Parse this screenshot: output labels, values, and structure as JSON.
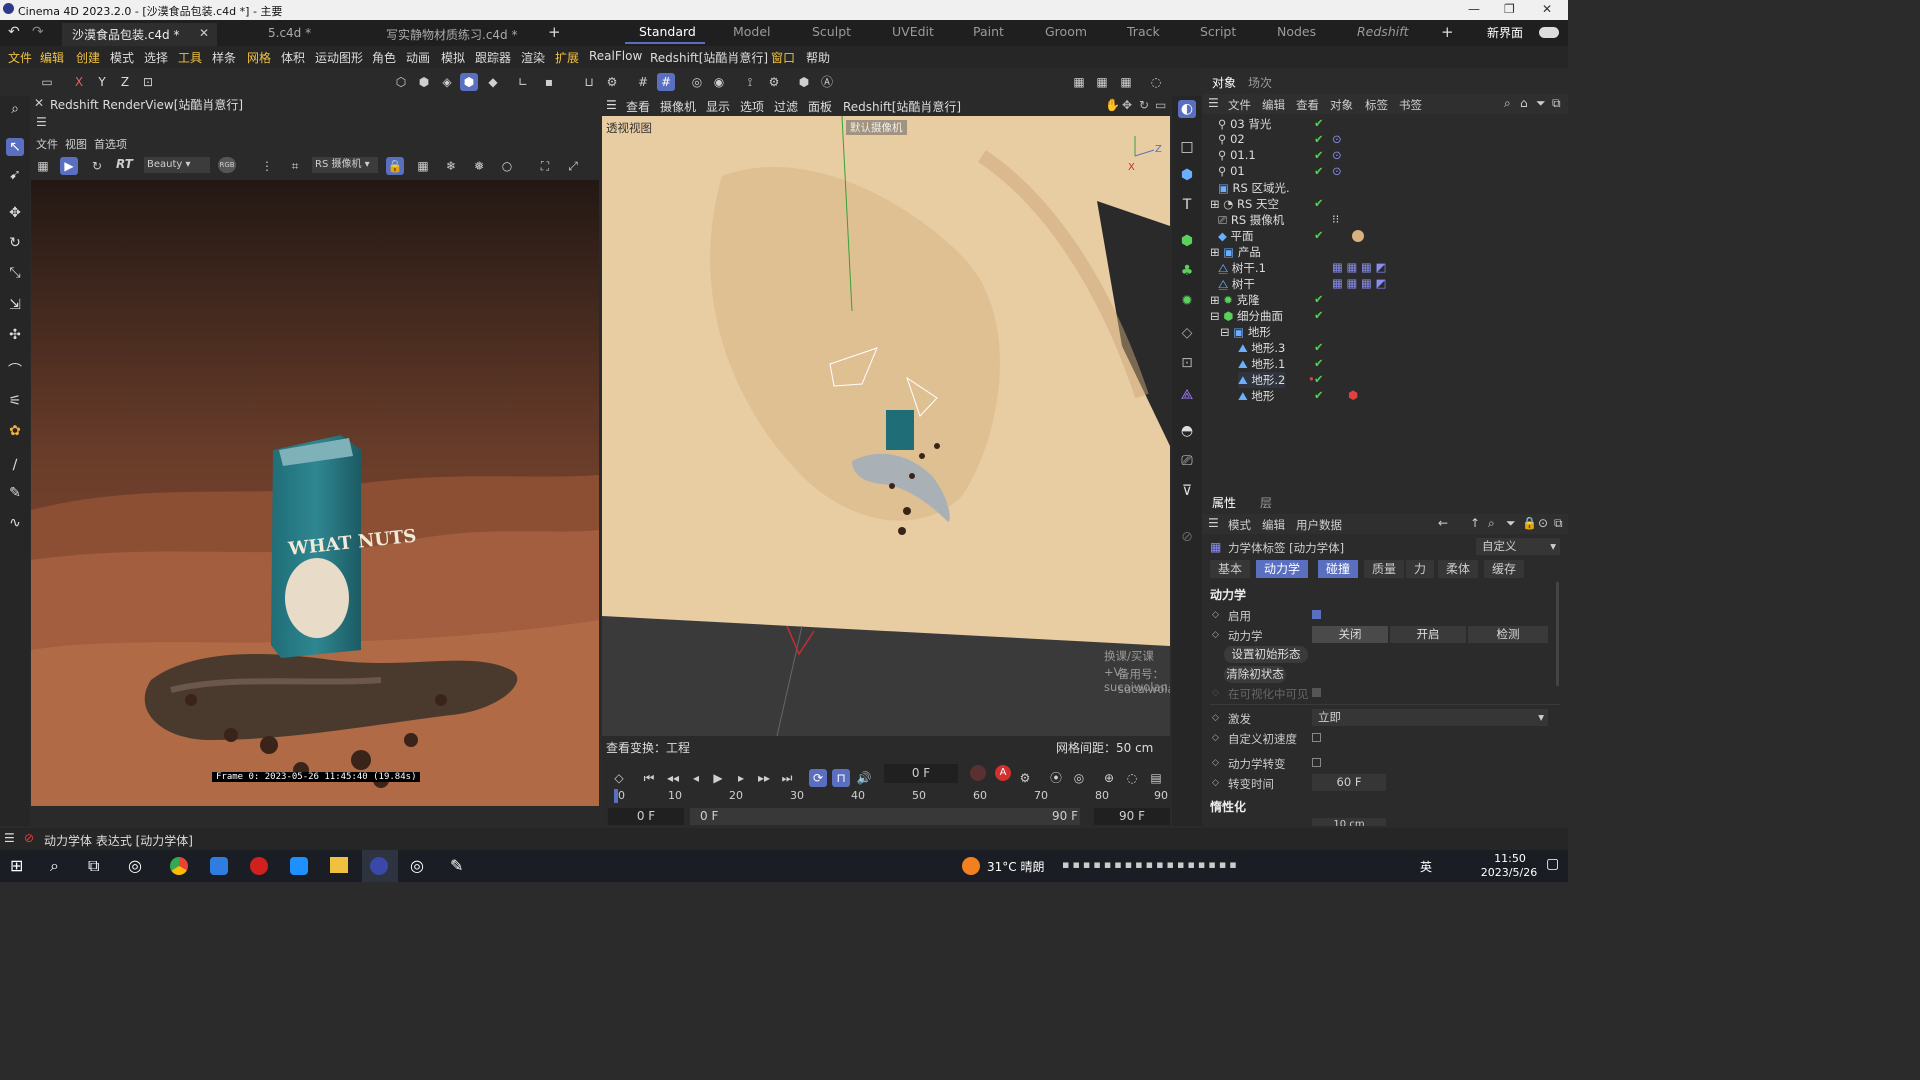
{
  "window": {
    "title": "Cinema 4D 2023.2.0 - [沙漠食品包装.c4d *] - 主要"
  },
  "doc_tabs": [
    {
      "label": "沙漠食品包装.c4d *",
      "active": true
    },
    {
      "label": "5.c4d *",
      "active": false
    },
    {
      "label": "写实静物材质练习.c4d *",
      "active": false
    }
  ],
  "layout_tabs": [
    "Standard",
    "Model",
    "Sculpt",
    "UVEdit",
    "Paint",
    "Groom",
    "Track",
    "Script",
    "Nodes",
    "Redshift"
  ],
  "new_interface": "新界面",
  "menu": [
    "文件",
    "编辑",
    "创建",
    "模式",
    "选择",
    "工具",
    "样条",
    "网格",
    "体积",
    "运动图形",
    "角色",
    "动画",
    "模拟",
    "跟踪器",
    "渲染",
    "扩展",
    "RealFlow",
    "Redshift[站酷肖意行]",
    "窗口",
    "帮助"
  ],
  "axes": {
    "x": "X",
    "y": "Y",
    "z": "Z"
  },
  "renderview": {
    "title": "Redshift RenderView[站酷肖意行]",
    "menu": [
      "文件",
      "视图",
      "首选项"
    ],
    "aov": "Beauty",
    "rgb": "RGB",
    "camera": "RS 摄像机",
    "rt": "RT",
    "frame_info": "Frame  0:  2023-05-26  11:45:40  (19.84s)",
    "package_text": "WHAT NUTS"
  },
  "viewport": {
    "menu": [
      "查看",
      "摄像机",
      "显示",
      "选项",
      "过滤",
      "面板",
      "Redshift[站酷肖意行]"
    ],
    "label": "透视视图",
    "camera_label": "默认摄像机",
    "watermark1": "换课/买课+V：sucaiwolan",
    "watermark2": "备用号：sucaiwolan",
    "footer_left": "查看变换：工程",
    "footer_right": "网格间距：50 cm"
  },
  "timeline": {
    "current_frame": "0 F",
    "ticks": [
      "0",
      "10",
      "20",
      "30",
      "40",
      "50",
      "60",
      "70",
      "80",
      "90"
    ],
    "start": "0 F",
    "range_start": "0 F",
    "range_end": "90 F",
    "end": "90 F"
  },
  "objects_panel": {
    "tabs": [
      "对象",
      "场次"
    ],
    "menu": [
      "文件",
      "编辑",
      "查看",
      "对象",
      "标签",
      "书签"
    ],
    "items": [
      "03 背光",
      "02",
      "01.1",
      "01",
      "RS 区域光.",
      "RS 天空",
      "RS 摄像机",
      "平面",
      "产品",
      "树干.1",
      "树干",
      "克隆",
      "细分曲面",
      "地形",
      "地形.3",
      "地形.1",
      "地形.2",
      "地形"
    ]
  },
  "attributes": {
    "tabs": [
      "属性",
      "层"
    ],
    "menu": [
      "模式",
      "编辑",
      "用户数据"
    ],
    "header": "力学体标签 [动力学体]",
    "preset": "自定义",
    "sub_tabs": [
      "基本",
      "动力学",
      "碰撞",
      "质量",
      "力",
      "柔体",
      "缓存"
    ],
    "section": "动力学",
    "enable_label": "启用",
    "dynamics_label": "动力学",
    "dyn_options": [
      "关闭",
      "开启",
      "检测"
    ],
    "set_initial": "设置初始形态",
    "clear_initial": "清除初状态",
    "visible_label": "在可视化中可见",
    "trigger_label": "激发",
    "trigger_value": "立即",
    "custom_init_label": "自定义初速度",
    "dyn_transition_label": "动力学转变",
    "transition_time_label": "转变时间",
    "transition_time": "60 F",
    "inertia_section": "惰性化",
    "linear_threshold": "10 cm"
  },
  "status": {
    "text": "动力学体 表达式 [动力学体]"
  },
  "taskbar": {
    "weather": "31°C  晴朗",
    "time": "11:50",
    "date": "2023/5/26",
    "ime": "英"
  },
  "colors": {
    "accent": "#5a6fc0",
    "check": "#4fd04f",
    "sand": "#e9cfa5"
  }
}
